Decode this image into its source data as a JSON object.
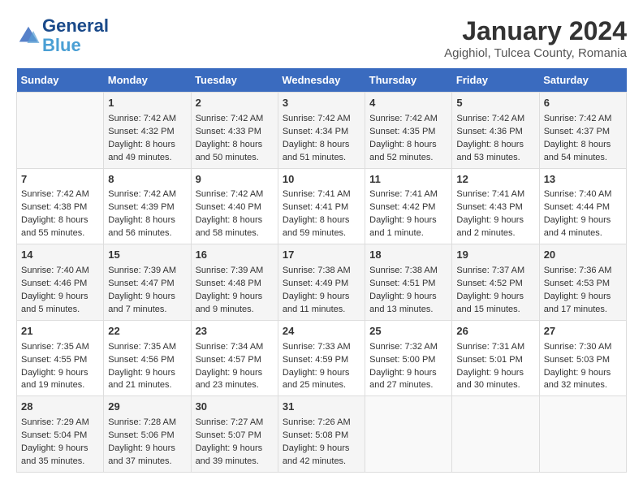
{
  "header": {
    "logo_line1": "General",
    "logo_line2": "Blue",
    "month_year": "January 2024",
    "location": "Agighiol, Tulcea County, Romania"
  },
  "weekdays": [
    "Sunday",
    "Monday",
    "Tuesday",
    "Wednesday",
    "Thursday",
    "Friday",
    "Saturday"
  ],
  "weeks": [
    [
      {
        "day": "",
        "sunrise": "",
        "sunset": "",
        "daylight": ""
      },
      {
        "day": "1",
        "sunrise": "Sunrise: 7:42 AM",
        "sunset": "Sunset: 4:32 PM",
        "daylight": "Daylight: 8 hours and 49 minutes."
      },
      {
        "day": "2",
        "sunrise": "Sunrise: 7:42 AM",
        "sunset": "Sunset: 4:33 PM",
        "daylight": "Daylight: 8 hours and 50 minutes."
      },
      {
        "day": "3",
        "sunrise": "Sunrise: 7:42 AM",
        "sunset": "Sunset: 4:34 PM",
        "daylight": "Daylight: 8 hours and 51 minutes."
      },
      {
        "day": "4",
        "sunrise": "Sunrise: 7:42 AM",
        "sunset": "Sunset: 4:35 PM",
        "daylight": "Daylight: 8 hours and 52 minutes."
      },
      {
        "day": "5",
        "sunrise": "Sunrise: 7:42 AM",
        "sunset": "Sunset: 4:36 PM",
        "daylight": "Daylight: 8 hours and 53 minutes."
      },
      {
        "day": "6",
        "sunrise": "Sunrise: 7:42 AM",
        "sunset": "Sunset: 4:37 PM",
        "daylight": "Daylight: 8 hours and 54 minutes."
      }
    ],
    [
      {
        "day": "7",
        "sunrise": "Sunrise: 7:42 AM",
        "sunset": "Sunset: 4:38 PM",
        "daylight": "Daylight: 8 hours and 55 minutes."
      },
      {
        "day": "8",
        "sunrise": "Sunrise: 7:42 AM",
        "sunset": "Sunset: 4:39 PM",
        "daylight": "Daylight: 8 hours and 56 minutes."
      },
      {
        "day": "9",
        "sunrise": "Sunrise: 7:42 AM",
        "sunset": "Sunset: 4:40 PM",
        "daylight": "Daylight: 8 hours and 58 minutes."
      },
      {
        "day": "10",
        "sunrise": "Sunrise: 7:41 AM",
        "sunset": "Sunset: 4:41 PM",
        "daylight": "Daylight: 8 hours and 59 minutes."
      },
      {
        "day": "11",
        "sunrise": "Sunrise: 7:41 AM",
        "sunset": "Sunset: 4:42 PM",
        "daylight": "Daylight: 9 hours and 1 minute."
      },
      {
        "day": "12",
        "sunrise": "Sunrise: 7:41 AM",
        "sunset": "Sunset: 4:43 PM",
        "daylight": "Daylight: 9 hours and 2 minutes."
      },
      {
        "day": "13",
        "sunrise": "Sunrise: 7:40 AM",
        "sunset": "Sunset: 4:44 PM",
        "daylight": "Daylight: 9 hours and 4 minutes."
      }
    ],
    [
      {
        "day": "14",
        "sunrise": "Sunrise: 7:40 AM",
        "sunset": "Sunset: 4:46 PM",
        "daylight": "Daylight: 9 hours and 5 minutes."
      },
      {
        "day": "15",
        "sunrise": "Sunrise: 7:39 AM",
        "sunset": "Sunset: 4:47 PM",
        "daylight": "Daylight: 9 hours and 7 minutes."
      },
      {
        "day": "16",
        "sunrise": "Sunrise: 7:39 AM",
        "sunset": "Sunset: 4:48 PM",
        "daylight": "Daylight: 9 hours and 9 minutes."
      },
      {
        "day": "17",
        "sunrise": "Sunrise: 7:38 AM",
        "sunset": "Sunset: 4:49 PM",
        "daylight": "Daylight: 9 hours and 11 minutes."
      },
      {
        "day": "18",
        "sunrise": "Sunrise: 7:38 AM",
        "sunset": "Sunset: 4:51 PM",
        "daylight": "Daylight: 9 hours and 13 minutes."
      },
      {
        "day": "19",
        "sunrise": "Sunrise: 7:37 AM",
        "sunset": "Sunset: 4:52 PM",
        "daylight": "Daylight: 9 hours and 15 minutes."
      },
      {
        "day": "20",
        "sunrise": "Sunrise: 7:36 AM",
        "sunset": "Sunset: 4:53 PM",
        "daylight": "Daylight: 9 hours and 17 minutes."
      }
    ],
    [
      {
        "day": "21",
        "sunrise": "Sunrise: 7:35 AM",
        "sunset": "Sunset: 4:55 PM",
        "daylight": "Daylight: 9 hours and 19 minutes."
      },
      {
        "day": "22",
        "sunrise": "Sunrise: 7:35 AM",
        "sunset": "Sunset: 4:56 PM",
        "daylight": "Daylight: 9 hours and 21 minutes."
      },
      {
        "day": "23",
        "sunrise": "Sunrise: 7:34 AM",
        "sunset": "Sunset: 4:57 PM",
        "daylight": "Daylight: 9 hours and 23 minutes."
      },
      {
        "day": "24",
        "sunrise": "Sunrise: 7:33 AM",
        "sunset": "Sunset: 4:59 PM",
        "daylight": "Daylight: 9 hours and 25 minutes."
      },
      {
        "day": "25",
        "sunrise": "Sunrise: 7:32 AM",
        "sunset": "Sunset: 5:00 PM",
        "daylight": "Daylight: 9 hours and 27 minutes."
      },
      {
        "day": "26",
        "sunrise": "Sunrise: 7:31 AM",
        "sunset": "Sunset: 5:01 PM",
        "daylight": "Daylight: 9 hours and 30 minutes."
      },
      {
        "day": "27",
        "sunrise": "Sunrise: 7:30 AM",
        "sunset": "Sunset: 5:03 PM",
        "daylight": "Daylight: 9 hours and 32 minutes."
      }
    ],
    [
      {
        "day": "28",
        "sunrise": "Sunrise: 7:29 AM",
        "sunset": "Sunset: 5:04 PM",
        "daylight": "Daylight: 9 hours and 35 minutes."
      },
      {
        "day": "29",
        "sunrise": "Sunrise: 7:28 AM",
        "sunset": "Sunset: 5:06 PM",
        "daylight": "Daylight: 9 hours and 37 minutes."
      },
      {
        "day": "30",
        "sunrise": "Sunrise: 7:27 AM",
        "sunset": "Sunset: 5:07 PM",
        "daylight": "Daylight: 9 hours and 39 minutes."
      },
      {
        "day": "31",
        "sunrise": "Sunrise: 7:26 AM",
        "sunset": "Sunset: 5:08 PM",
        "daylight": "Daylight: 9 hours and 42 minutes."
      },
      {
        "day": "",
        "sunrise": "",
        "sunset": "",
        "daylight": ""
      },
      {
        "day": "",
        "sunrise": "",
        "sunset": "",
        "daylight": ""
      },
      {
        "day": "",
        "sunrise": "",
        "sunset": "",
        "daylight": ""
      }
    ]
  ]
}
